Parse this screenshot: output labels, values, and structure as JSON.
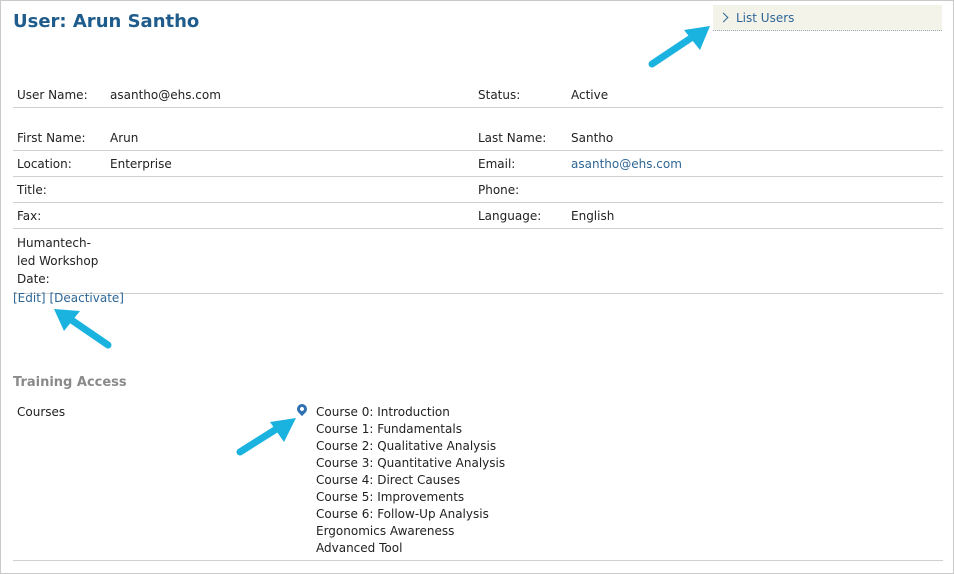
{
  "page": {
    "title": "User: Arun Santho"
  },
  "sidebar": {
    "list_users": "List Users"
  },
  "user": {
    "username_label": "User Name:",
    "username": "asantho@ehs.com",
    "status_label": "Status:",
    "status": "Active",
    "first_name_label": "First Name:",
    "first_name": "Arun",
    "last_name_label": "Last Name:",
    "last_name": "Santho",
    "location_label": "Location:",
    "location": "Enterprise",
    "email_label": "Email:",
    "email": "asantho@ehs.com",
    "title_label": "Title:",
    "title": "",
    "phone_label": "Phone:",
    "phone": "",
    "fax_label": "Fax:",
    "fax": "",
    "language_label": "Language:",
    "language": "English",
    "workshop_label": "Humantech-led Workshop Date:",
    "workshop_date": ""
  },
  "actions": {
    "edit": "[Edit]",
    "deactivate": "[Deactivate]"
  },
  "training": {
    "heading": "Training Access",
    "courses_label": "Courses",
    "courses": [
      "Course 0: Introduction",
      "Course 1: Fundamentals",
      "Course 2: Qualitative Analysis",
      "Course 3: Quantitative Analysis",
      "Course 4: Direct Causes",
      "Course 5: Improvements",
      "Course 6: Follow-Up Analysis",
      "Ergonomics Awareness",
      "Advanced Tool"
    ]
  },
  "colors": {
    "accent": "#1f5c8b",
    "link": "#2e6696",
    "callout_arrow": "#1ab3e0"
  }
}
